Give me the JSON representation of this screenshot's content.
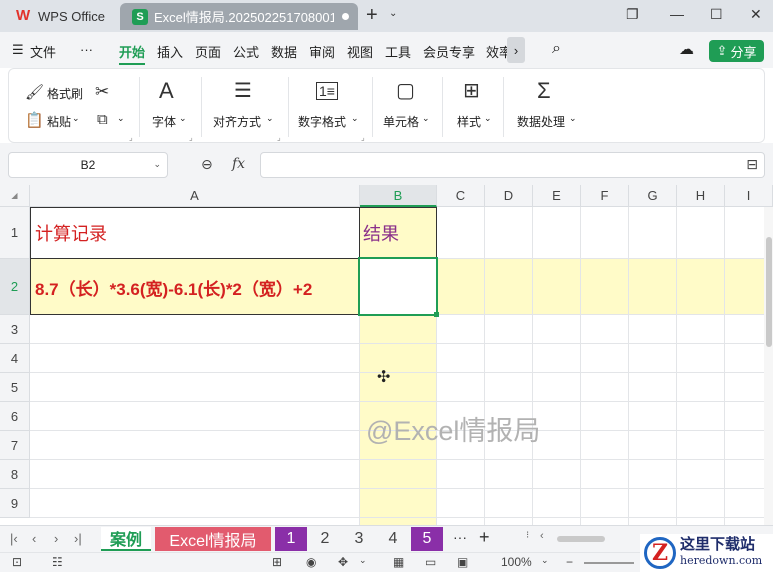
{
  "titlebar": {
    "app_name": "WPS Office",
    "doc_tab_title": "Excel情报局.202502251708001",
    "plus": "+",
    "chevron": "⌄",
    "restore": "❐",
    "minimize": "—",
    "maximize": "☐",
    "close": "✕"
  },
  "menu": {
    "file": "文件",
    "more": "···",
    "items": [
      "开始",
      "插入",
      "页面",
      "公式",
      "数据",
      "审阅",
      "视图",
      "工具",
      "会员专享",
      "效率"
    ],
    "share": "分享"
  },
  "ribbon": {
    "format_painter": "格式刷",
    "paste": "粘贴",
    "font": "字体",
    "align": "对齐方式",
    "number_format": "数字格式",
    "cell": "单元格",
    "style": "样式",
    "data_processing": "数据处理"
  },
  "formula": {
    "name_box": "B2",
    "fx": "fx",
    "value": ""
  },
  "grid": {
    "columns": [
      "A",
      "B",
      "C",
      "D",
      "E",
      "F",
      "G",
      "H",
      "I"
    ],
    "rows": [
      "1",
      "2",
      "3",
      "4",
      "5",
      "6",
      "7",
      "8",
      "9"
    ],
    "a1": "计算记录",
    "b1": "结果",
    "a2": "8.7（长）*3.6(宽)-6.1(长)*2（宽）+2",
    "b2": "",
    "watermark": "@Excel情报局",
    "text_color": "#d42121",
    "b1_color": "#8a2f8a",
    "highlight_color": "#fffbc8",
    "selection_color": "#1f9d55"
  },
  "sheets": {
    "nav": [
      "|‹",
      "‹",
      "›",
      "›|"
    ],
    "tabs": [
      {
        "label": "案例",
        "bg": "#ffffff",
        "fg": "#1f9d55"
      },
      {
        "label": "Excel情报局",
        "bg": "#e25b6e",
        "fg": "#ffffff"
      },
      {
        "label": "1",
        "bg": "#8a2fa8",
        "fg": "#ffffff"
      },
      {
        "label": "2",
        "bg": "#f3f4f6",
        "fg": "#444444"
      },
      {
        "label": "3",
        "bg": "#f3f4f6",
        "fg": "#444444"
      },
      {
        "label": "4",
        "bg": "#f3f4f6",
        "fg": "#444444"
      },
      {
        "label": "5",
        "bg": "#8a2fa8",
        "fg": "#ffffff"
      }
    ],
    "more": "···",
    "add": "+"
  },
  "status": {
    "zoom": "100%",
    "zoom_chevron": "⌄"
  },
  "site_logo": {
    "mark": "Z",
    "cn": "这里下载站",
    "en": "heredown.com"
  }
}
